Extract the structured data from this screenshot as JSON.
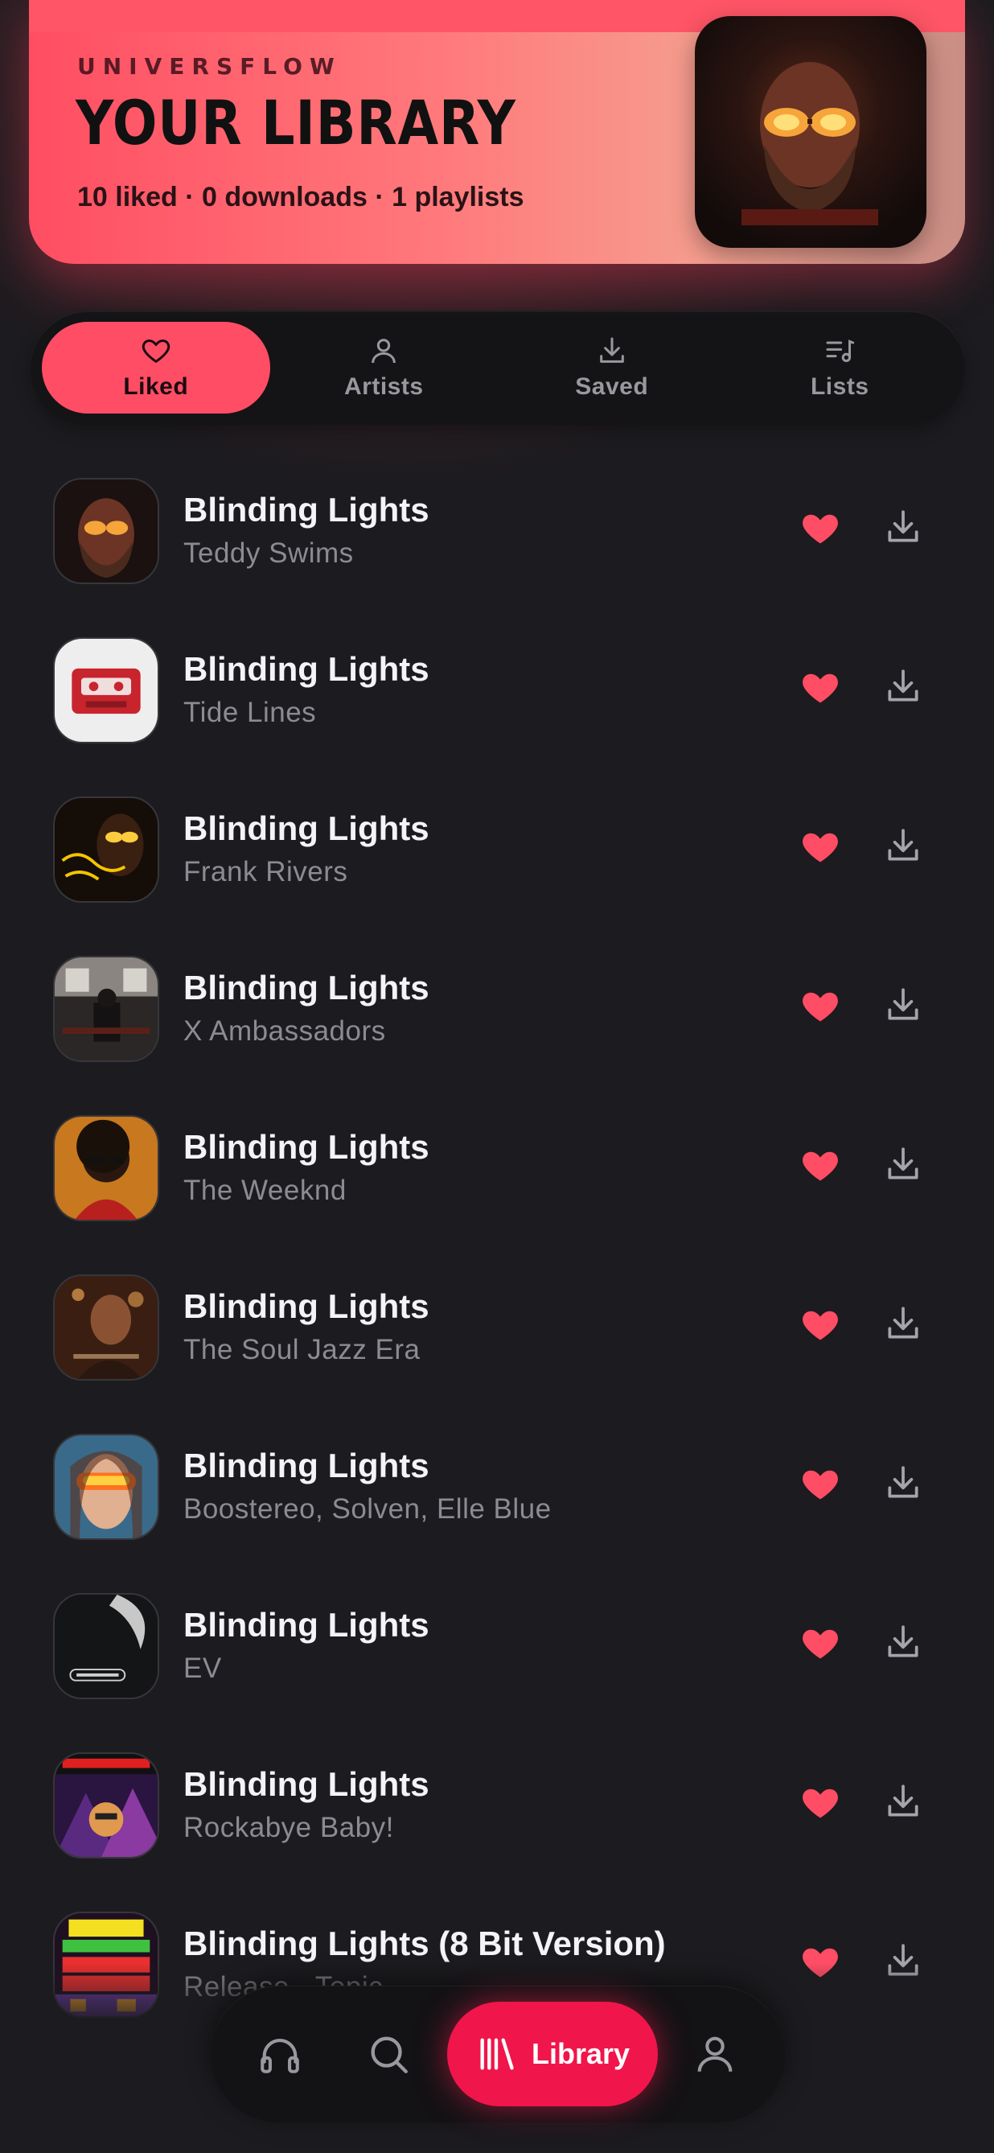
{
  "header": {
    "brand": "UNIVERSFLOW",
    "title": "YOUR LIBRARY",
    "stats": "10 liked · 0 downloads · 1 playlists"
  },
  "tabs": [
    {
      "label": "Liked",
      "icon": "heart-icon",
      "active": true
    },
    {
      "label": "Artists",
      "icon": "person-icon",
      "active": false
    },
    {
      "label": "Saved",
      "icon": "download-icon",
      "active": false
    },
    {
      "label": "Lists",
      "icon": "playlist-icon",
      "active": false
    }
  ],
  "tracks": [
    {
      "title": "Blinding Lights",
      "artist": "Teddy Swims"
    },
    {
      "title": "Blinding Lights",
      "artist": "Tide Lines"
    },
    {
      "title": "Blinding Lights",
      "artist": "Frank Rivers"
    },
    {
      "title": "Blinding Lights",
      "artist": "X Ambassadors"
    },
    {
      "title": "Blinding Lights",
      "artist": "The Weeknd"
    },
    {
      "title": "Blinding Lights",
      "artist": "The Soul Jazz Era"
    },
    {
      "title": "Blinding Lights",
      "artist": "Boostereo, Solven, Elle Blue"
    },
    {
      "title": "Blinding Lights",
      "artist": "EV"
    },
    {
      "title": "Blinding Lights",
      "artist": "Rockabye Baby!"
    },
    {
      "title": "Blinding Lights (8 Bit Version)",
      "artist": "Release - Topic"
    }
  ],
  "nav": {
    "items": [
      "headphones-icon",
      "search-icon",
      "library-icon",
      "profile-icon"
    ],
    "active_label": "Library"
  },
  "colors": {
    "accent": "#ff4d65",
    "nav_active": "#f0154a",
    "background": "#1c1b1f"
  }
}
